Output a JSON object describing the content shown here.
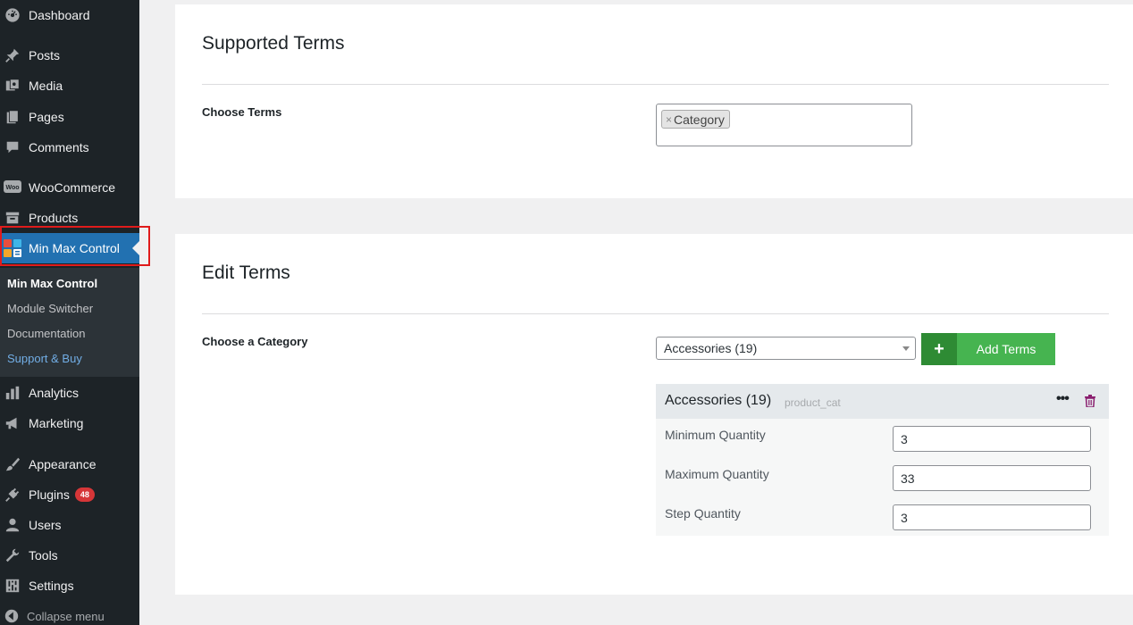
{
  "sidebar": {
    "menu": [
      {
        "id": "dashboard",
        "label": "Dashboard",
        "icon": "dashboard-icon"
      },
      {
        "id": "posts",
        "label": "Posts",
        "icon": "pin-icon"
      },
      {
        "id": "media",
        "label": "Media",
        "icon": "media-icon"
      },
      {
        "id": "pages",
        "label": "Pages",
        "icon": "pages-icon"
      },
      {
        "id": "comments",
        "label": "Comments",
        "icon": "comment-icon"
      },
      {
        "id": "woocommerce",
        "label": "WooCommerce",
        "icon": "woocommerce-icon"
      },
      {
        "id": "products",
        "label": "Products",
        "icon": "archive-icon"
      },
      {
        "id": "min-max-control",
        "label": "Min Max Control",
        "icon": "min-max-control-icon",
        "active": true
      },
      {
        "id": "analytics",
        "label": "Analytics",
        "icon": "bar-chart-icon"
      },
      {
        "id": "marketing",
        "label": "Marketing",
        "icon": "megaphone-icon"
      },
      {
        "id": "appearance",
        "label": "Appearance",
        "icon": "paintbrush-icon"
      },
      {
        "id": "plugins",
        "label": "Plugins",
        "icon": "plug-icon",
        "badge": "48"
      },
      {
        "id": "users",
        "label": "Users",
        "icon": "user-icon"
      },
      {
        "id": "tools",
        "label": "Tools",
        "icon": "wrench-icon"
      },
      {
        "id": "settings",
        "label": "Settings",
        "icon": "settings-sliders-icon"
      }
    ],
    "submenu": [
      {
        "label": "Min Max Control"
      },
      {
        "label": "Module Switcher"
      },
      {
        "label": "Documentation"
      },
      {
        "label": "Support & Buy"
      }
    ],
    "collapse_label": "Collapse menu"
  },
  "supported_terms": {
    "title": "Supported Terms",
    "choose_label": "Choose Terms",
    "chip_remove": "×",
    "chip_label": "Category"
  },
  "edit_terms": {
    "title": "Edit Terms",
    "choose_label": "Choose a Category",
    "select_value": "Accessories (19)",
    "add_button": "Add Terms",
    "add_plus": "+",
    "term": {
      "title": "Accessories (19)",
      "taxonomy": "product_cat",
      "menu": "•••",
      "fields": [
        {
          "label": "Minimum Quantity",
          "value": "3"
        },
        {
          "label": "Maximum Quantity",
          "value": "33"
        },
        {
          "label": "Step Quantity",
          "value": "3"
        }
      ]
    }
  },
  "colors": {
    "sidebar_bg": "#1d2327",
    "active": "#2271b1",
    "add_button": "#46b450",
    "badge": "#d63638"
  }
}
